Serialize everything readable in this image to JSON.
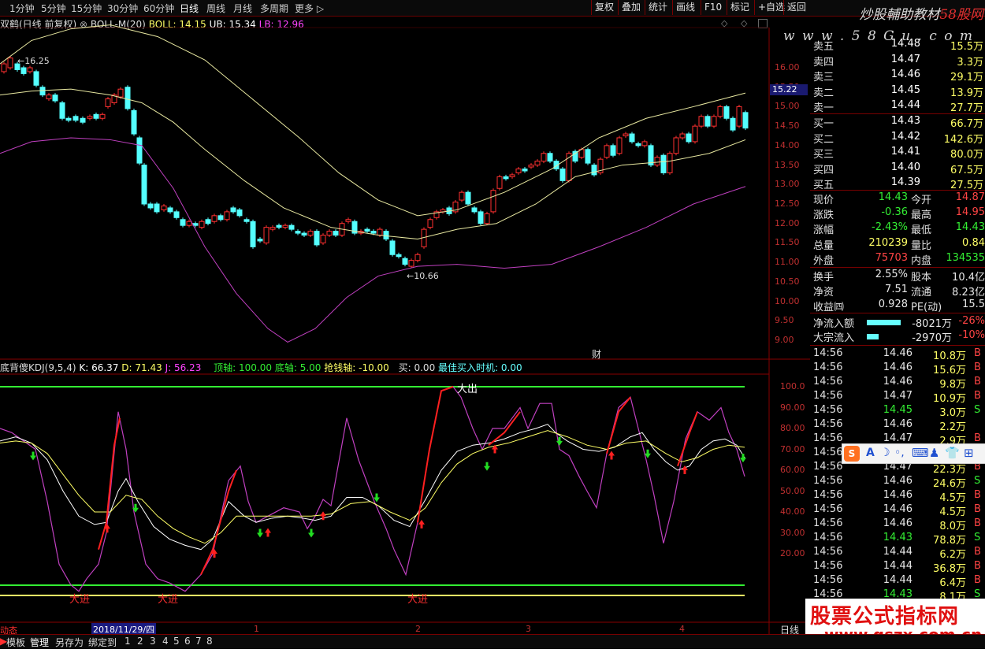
{
  "toolbar": {
    "periods": [
      "1分钟",
      "5分钟",
      "15分钟",
      "30分钟",
      "60分钟",
      "日线",
      "周线",
      "月线",
      "多周期",
      "更多 ▷"
    ],
    "active_period": "日线",
    "right_buttons": [
      "复权",
      "叠加",
      "统计",
      "画线",
      "F10",
      "标记",
      "+自选",
      "返回"
    ]
  },
  "watermark": {
    "title_a": "炒股輔助教材",
    "title_b": "58股网",
    "url": "w w w . 5 8 G u . c o m",
    "bottom_title": "股票公式指标网",
    "bottom_url": "www.gszx.com.cn"
  },
  "main_chart": {
    "title": "双鹤(日线 前复权)",
    "indicator": "BOLL-M(20)",
    "boll": "BOLL: 14.15",
    "ub": "UB: 15.34",
    "lb": "LB: 12.96",
    "high_label": "16.25",
    "low_label": "10.66",
    "current_price_tag": "15.22",
    "axis": [
      "16.00",
      "15.50",
      "15.00",
      "14.50",
      "14.00",
      "13.50",
      "13.00",
      "12.50",
      "12.00",
      "11.50",
      "11.00",
      "10.50",
      "10.00",
      "9.50",
      "9.00"
    ],
    "event_marker": "财"
  },
  "kdj_chart": {
    "title": "底背傻KDJ(9,5,4)",
    "k": "K: 66.37",
    "d": "D: 71.43",
    "j": "J: 56.23",
    "top_axis": "顶轴: 100.00",
    "bottom_axis": "底轴: 5.00",
    "money_axis": "抢钱轴: -10.00",
    "buy": "买: 0.00",
    "best_time": "最佳买入时机: 0.00",
    "big_out_label": "大出",
    "big_in_label": "大进",
    "axis": [
      "100.0",
      "90.00",
      "80.00",
      "70.00",
      "60.00",
      "50.00",
      "40.00",
      "30.00",
      "20.00"
    ]
  },
  "quote": {
    "sell": [
      {
        "label": "卖五",
        "price": "14.48",
        "vol": "15.5万"
      },
      {
        "label": "卖四",
        "price": "14.47",
        "vol": "3.3万"
      },
      {
        "label": "卖三",
        "price": "14.46",
        "vol": "29.1万"
      },
      {
        "label": "卖二",
        "price": "14.45",
        "vol": "13.9万"
      },
      {
        "label": "卖一",
        "price": "14.44",
        "vol": "27.7万"
      }
    ],
    "buy": [
      {
        "label": "买一",
        "price": "14.43",
        "vol": "66.7万"
      },
      {
        "label": "买二",
        "price": "14.42",
        "vol": "142.6万"
      },
      {
        "label": "买三",
        "price": "14.41",
        "vol": "80.0万"
      },
      {
        "label": "买四",
        "price": "14.40",
        "vol": "67.5万"
      },
      {
        "label": "买五",
        "price": "14.39",
        "vol": "27.5万"
      }
    ],
    "stats": [
      {
        "l1": "现价",
        "v1": "14.43",
        "c1": "green",
        "l2": "今开",
        "v2": "14.87",
        "c2": "red"
      },
      {
        "l1": "涨跌",
        "v1": "-0.36",
        "c1": "green",
        "l2": "最高",
        "v2": "14.95",
        "c2": "red"
      },
      {
        "l1": "涨幅",
        "v1": "-2.43%",
        "c1": "green",
        "l2": "最低",
        "v2": "14.43",
        "c2": "green"
      },
      {
        "l1": "总量",
        "v1": "210239",
        "c1": "yellow",
        "l2": "量比",
        "v2": "0.84",
        "c2": "yellow"
      },
      {
        "l1": "外盘",
        "v1": "75703",
        "c1": "red",
        "l2": "内盘",
        "v2": "134535",
        "c2": "green"
      }
    ],
    "stats2": [
      {
        "l1": "换手",
        "v1": "2.55%",
        "l2": "股本",
        "v2": "10.4亿"
      },
      {
        "l1": "净资",
        "v1": "7.51",
        "l2": "流通",
        "v2": "8.23亿"
      },
      {
        "l1": "收益㈣",
        "v1": "0.928",
        "l2": "PE(动)",
        "v2": "15.5"
      }
    ],
    "flows": [
      {
        "label": "净流入额",
        "value": "-8021万",
        "pct": "-26%",
        "bar": 0.62
      },
      {
        "label": "大宗流入",
        "value": "-2970万",
        "pct": "-10%",
        "bar": 0.22
      }
    ]
  },
  "ticks": [
    {
      "time": "14:56",
      "price": "14.46",
      "vol": "10.8万",
      "bs": "B",
      "c": "red"
    },
    {
      "time": "14:56",
      "price": "14.46",
      "vol": "15.6万",
      "bs": "B",
      "c": "red"
    },
    {
      "time": "14:56",
      "price": "14.46",
      "vol": "9.8万",
      "bs": "B",
      "c": "red"
    },
    {
      "time": "14:56",
      "price": "14.47",
      "vol": "10.9万",
      "bs": "B",
      "c": "red"
    },
    {
      "time": "14:56",
      "price": "14.45",
      "vol": "3.0万",
      "bs": "S",
      "c": "green"
    },
    {
      "time": "14:56",
      "price": "14.46",
      "vol": "2.2万",
      "bs": "",
      "c": "red"
    },
    {
      "time": "14:56",
      "price": "14.47",
      "vol": "2.9万",
      "bs": "B",
      "c": "red"
    },
    {
      "time": "14:56",
      "price": "",
      "vol": "",
      "bs": "",
      "c": "red"
    },
    {
      "time": "14:56",
      "price": "14.47",
      "vol": "22.3万",
      "bs": "B",
      "c": "red"
    },
    {
      "time": "14:56",
      "price": "14.46",
      "vol": "24.6万",
      "bs": "S",
      "c": "red"
    },
    {
      "time": "14:56",
      "price": "14.46",
      "vol": "4.5万",
      "bs": "B",
      "c": "red"
    },
    {
      "time": "14:56",
      "price": "14.46",
      "vol": "4.5万",
      "bs": "B",
      "c": "red"
    },
    {
      "time": "14:56",
      "price": "14.46",
      "vol": "8.0万",
      "bs": "B",
      "c": "red"
    },
    {
      "time": "14:56",
      "price": "14.43",
      "vol": "78.8万",
      "bs": "S",
      "c": "green"
    },
    {
      "time": "14:56",
      "price": "14.44",
      "vol": "6.2万",
      "bs": "B",
      "c": "red"
    },
    {
      "time": "14:56",
      "price": "14.44",
      "vol": "36.8万",
      "bs": "B",
      "c": "red"
    },
    {
      "time": "14:56",
      "price": "14.44",
      "vol": "6.4万",
      "bs": "B",
      "c": "red"
    },
    {
      "time": "14:56",
      "price": "14.43",
      "vol": "8.1万",
      "bs": "S",
      "c": "green"
    }
  ],
  "timeline": {
    "left_label": "动态",
    "date": "2018/11/29/四",
    "months": [
      "1",
      "2",
      "3",
      "4"
    ],
    "right_label": "日线"
  },
  "bottom_tabs": [
    "模板",
    "管理",
    "另存为",
    "绑定到",
    "1",
    "2",
    "3",
    "4",
    "5",
    "6",
    "7",
    "8"
  ],
  "ime_bar": [
    "S",
    "A",
    "☽",
    "◦,",
    "⌨",
    "♟",
    "👕",
    "⊞"
  ]
}
